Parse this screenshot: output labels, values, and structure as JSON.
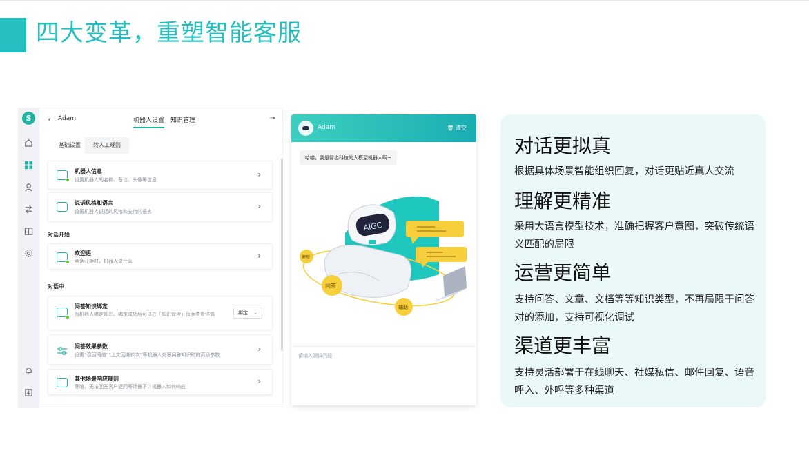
{
  "slide": {
    "title": "四大变革，重塑智能客服",
    "accent_color": "#26bfbf"
  },
  "settings_app": {
    "logo_letter": "S",
    "rail_icons": [
      "home-icon",
      "apps-icon",
      "users-icon",
      "flow-icon",
      "book-icon",
      "gear-icon",
      "bell-icon",
      "export-icon"
    ],
    "header": {
      "bot_name": "Adam",
      "tabs": [
        "机器人设置",
        "知识管理"
      ],
      "active_tab": 0
    },
    "subtabs": [
      "基础设置",
      "转人工规则"
    ],
    "cards": {
      "robot_info": {
        "title": "机器人信息",
        "desc": "设置机器人的名称、备注、头像等信息"
      },
      "style_lang": {
        "title": "说话风格和语言",
        "desc": "设置机器人说话的风格和支持的语言"
      },
      "welcome": {
        "title": "欢迎语",
        "desc": "会话开始时，机器人说什么"
      },
      "qa_binding": {
        "title": "问答知识绑定",
        "desc": "为机器人绑定知识。绑定成功后可以在「知识管理」页面查看详情",
        "button": "绑定"
      },
      "qa_params": {
        "title": "问答效果参数",
        "desc": "设置“召回阈值”“上文回溯轮次”等机器人处理问答知识时的高级参数"
      },
      "other_rules": {
        "title": "其他场景响应规则",
        "desc": "寒暄、无法回答客户提问等场景下，机器人如何响应"
      }
    },
    "sections": {
      "conversation_start": "对话开始",
      "in_conversation": "对话中"
    }
  },
  "chat_preview": {
    "bot_name": "Adam",
    "clear_label": "清空",
    "greeting": "哈喽，我是智齿科技的大模型机器人啊~",
    "illustration": {
      "screen_text": "AIGC",
      "orbit_labels": [
        "寒暄",
        "问答",
        "辅助"
      ]
    },
    "input_placeholder": "请输入测试问题",
    "header_gradient": [
      "#3ccfc0",
      "#1aaeb3"
    ]
  },
  "features": [
    {
      "heading": "对话更拟真",
      "body": "根据具体场景智能组织回复，对话更贴近真人交流"
    },
    {
      "heading": "理解更精准",
      "body": "采用大语言模型技术，准确把握客户意图，突破传统语义匹配的局限"
    },
    {
      "heading": "运营更简单",
      "body": "支持问答、文章、文档等等知识类型，不再局限于问答对的添加，支持可视化调试"
    },
    {
      "heading": "渠道更丰富",
      "body": "支持灵活部署于在线聊天、社媒私信、邮件回复、语音呼入、外呼等多种渠道"
    }
  ],
  "colors": {
    "brand": "#1fb3a0",
    "panel_bg": "#eaf8f7",
    "online_dot": "#52c41a",
    "bubble_yellow": "#f7cf3c"
  }
}
